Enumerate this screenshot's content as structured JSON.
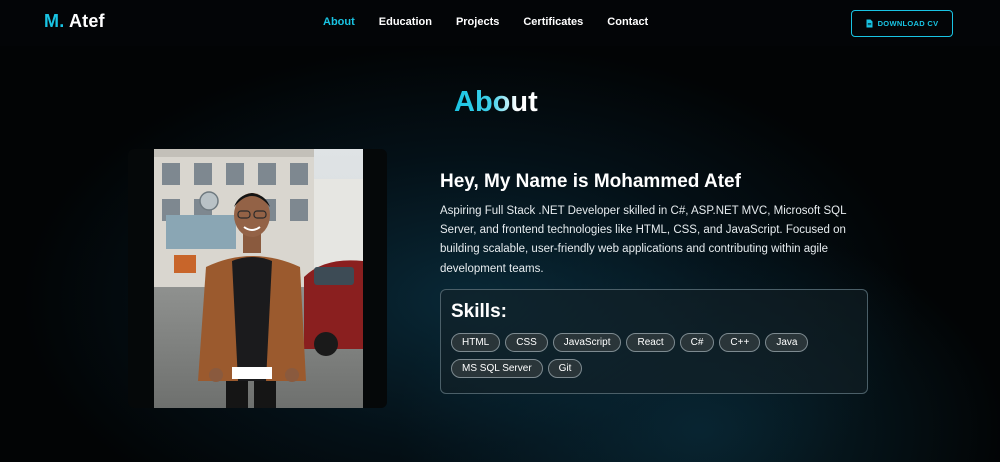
{
  "brand": {
    "accent": "M.",
    "name": "Atef"
  },
  "nav": {
    "items": [
      {
        "label": "About",
        "active": true
      },
      {
        "label": "Education"
      },
      {
        "label": "Projects"
      },
      {
        "label": "Certificates"
      },
      {
        "label": "Contact"
      }
    ],
    "download_cv_label": "DOWNLOAD CV",
    "download_icon": "file-icon"
  },
  "about": {
    "title": "About",
    "heading": "Hey, My Name is Mohammed Atef",
    "bio": "Aspiring Full Stack .NET Developer skilled in C#, ASP.NET MVC, Microsoft SQL Server, and frontend technologies like HTML, CSS, and JavaScript. Focused on building scalable, user-friendly web applications and contributing within agile development teams.",
    "skills_title": "Skills:",
    "skills": [
      "HTML",
      "CSS",
      "JavaScript",
      "React",
      "C#",
      "C++",
      "Java",
      "MS SQL Server",
      "Git"
    ]
  },
  "colors": {
    "accent": "#19c4e3",
    "background": "#020405",
    "glow": "#0e465f"
  }
}
